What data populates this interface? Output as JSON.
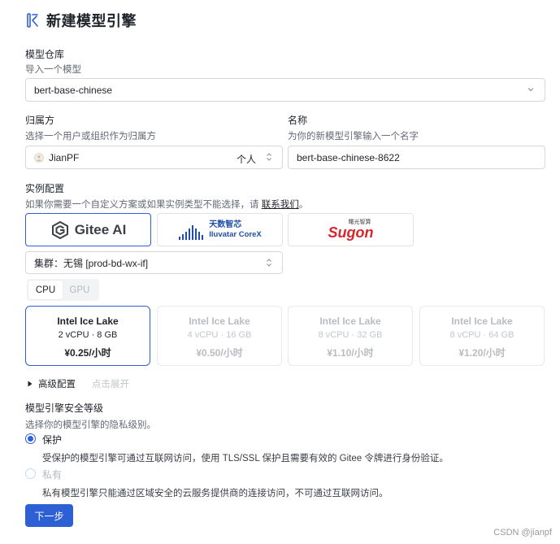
{
  "page": {
    "title": "新建模型引擎"
  },
  "repo": {
    "label": "模型仓库",
    "hint": "导入一个模型",
    "value": "bert-base-chinese"
  },
  "owner": {
    "label": "归属方",
    "hint": "选择一个用户或组织作为归属方",
    "value": "JianPF",
    "type": "个人"
  },
  "name": {
    "label": "名称",
    "hint": "为你的新模型引擎输入一个名字",
    "value": "bert-base-chinese-8622"
  },
  "instance": {
    "label": "实例配置",
    "hint": "如果你需要一个自定义方案或如果实例类型不能选择，请",
    "contact_link": "联系我们",
    "hint_end": "。",
    "providers": [
      {
        "name": "Gitee AI",
        "selected": true
      },
      {
        "name": "天数智芯",
        "sub": "Iluvatar CoreX",
        "selected": false
      },
      {
        "name": "曙光智算",
        "brand": "Sugon",
        "selected": false
      }
    ],
    "cluster": "集群：无锡 [prod-bd-wx-if]",
    "tabs": [
      "CPU",
      "GPU"
    ],
    "active_tab": "CPU",
    "cards": [
      {
        "name": "Intel Ice Lake",
        "spec": "2 vCPU · 8 GB",
        "price": "¥0.25/小时",
        "selected": true
      },
      {
        "name": "Intel Ice Lake",
        "spec": "4 vCPU · 16 GB",
        "price": "¥0.50/小时",
        "selected": false
      },
      {
        "name": "Intel Ice Lake",
        "spec": "8 vCPU · 32 GB",
        "price": "¥1.10/小时",
        "selected": false
      },
      {
        "name": "Intel Ice Lake",
        "spec": "8 vCPU · 64 GB",
        "price": "¥1.20/小时",
        "selected": false
      }
    ]
  },
  "advanced": {
    "label": "高级配置",
    "expand": "点击展开"
  },
  "security": {
    "label": "模型引擎安全等级",
    "hint": "选择你的模型引擎的隐私级别。",
    "options": [
      {
        "title": "保护",
        "desc": "受保护的模型引擎可通过互联网访问，使用 TLS/SSL 保护且需要有效的 Gitee 令牌进行身份验证。",
        "selected": true
      },
      {
        "title": "私有",
        "desc": "私有模型引擎只能通过区域安全的云服务提供商的连接访问，不可通过互联网访问。",
        "selected": false
      }
    ]
  },
  "next_button": "下一步",
  "watermark": "CSDN @jianpf",
  "colors": {
    "accent": "#2d5fd5",
    "border": "#d4d7dc",
    "muted": "#646a73",
    "sugon_red": "#d8262b"
  }
}
